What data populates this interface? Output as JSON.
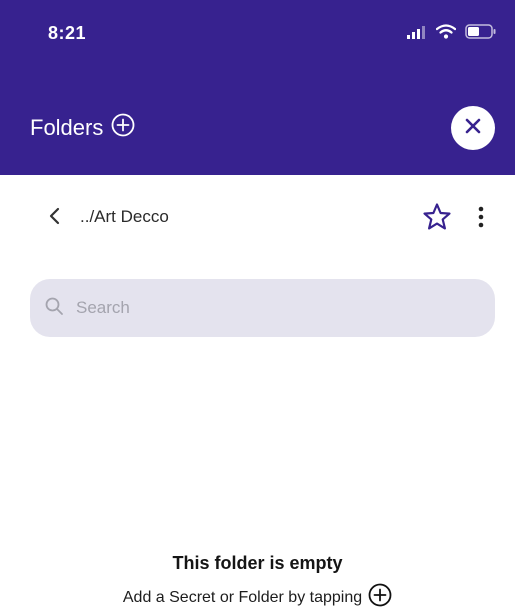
{
  "status_bar": {
    "time": "8:21",
    "icons": [
      "signal-icon",
      "wifi-icon",
      "battery-icon"
    ]
  },
  "header": {
    "title": "Folders",
    "add_icon": "plus-circle-icon",
    "close_icon": "close-icon",
    "background_color": "#37228f"
  },
  "breadcrumb": {
    "back_icon": "chevron-left-icon",
    "path": "../Art Decco",
    "favorite_icon": "star-outline-icon",
    "more_icon": "more-vertical-icon"
  },
  "search": {
    "placeholder": "Search",
    "value": "",
    "icon": "search-icon"
  },
  "empty_state": {
    "title": "This folder is empty",
    "subtitle": "Add a Secret or Folder by tapping",
    "icon": "plus-circle-icon"
  }
}
